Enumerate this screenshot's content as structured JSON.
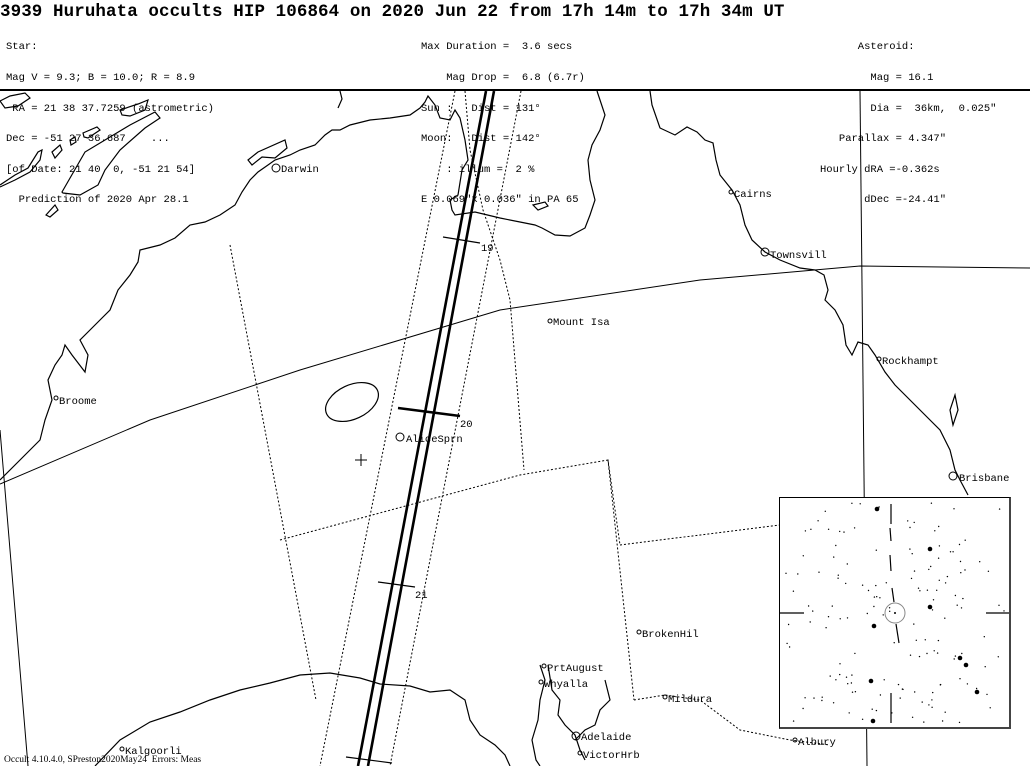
{
  "title": "3939 Huruhata occults HIP 106864 on 2020 Jun 22 from 17h 14m to 17h 34m UT",
  "star": {
    "heading": "Star:",
    "lines": [
      "Mag V = 9.3; B = 10.0; R = 8.9",
      " RA = 21 38 37.7259 (astrometric)",
      "Dec = -51 27 36.687    ...",
      "[of Date: 21 40  0, -51 21 54]",
      "  Prediction of 2020 Apr 28.1"
    ]
  },
  "event": {
    "lines": [
      "Max Duration =  3.6 secs",
      "    Mag Drop =  6.8 (6.7r)",
      "Sun :   Dist = 131°",
      "Moon:   Dist = 142°",
      "    : illum =  2 %",
      "E 0.069\"x 0.036\" in PA 65"
    ]
  },
  "asteroid": {
    "heading": "      Asteroid:",
    "lines": [
      "        Mag = 16.1",
      "        Dia =  36km,  0.025\"",
      "   Parallax = 4.347\"",
      "Hourly dRA =-0.362s",
      "       dDec =-24.41\""
    ]
  },
  "cities": [
    {
      "name": "Darwin",
      "label": "Darwin"
    },
    {
      "name": "Cairns",
      "label": "Cairns"
    },
    {
      "name": "Townsville",
      "label": "Townsvill"
    },
    {
      "name": "Mount Isa",
      "label": "Mount Isa"
    },
    {
      "name": "Rockhampton",
      "label": "Rockhampt"
    },
    {
      "name": "Broome",
      "label": "Broome"
    },
    {
      "name": "Alice Springs",
      "label": "AliceSprn"
    },
    {
      "name": "Brisbane",
      "label": "Brisbane"
    },
    {
      "name": "Broken Hill",
      "label": "BrokenHil"
    },
    {
      "name": "Port Augusta",
      "label": "PrtAugust"
    },
    {
      "name": "Whyalla",
      "label": "Whyalla"
    },
    {
      "name": "Mildura",
      "label": "Mildura"
    },
    {
      "name": "Adelaide",
      "label": "Adelaide"
    },
    {
      "name": "Victor Harbor",
      "label": "VictorHrb"
    },
    {
      "name": "Albury",
      "label": "Albury"
    },
    {
      "name": "Kalgoorlie",
      "label": "Kalgoorli"
    }
  ],
  "time_ticks": [
    {
      "label": "19"
    },
    {
      "label": "20"
    },
    {
      "label": "21"
    }
  ],
  "footer": "Occult 4.10.4.0, SPreston2020May24  Errors: Meas"
}
